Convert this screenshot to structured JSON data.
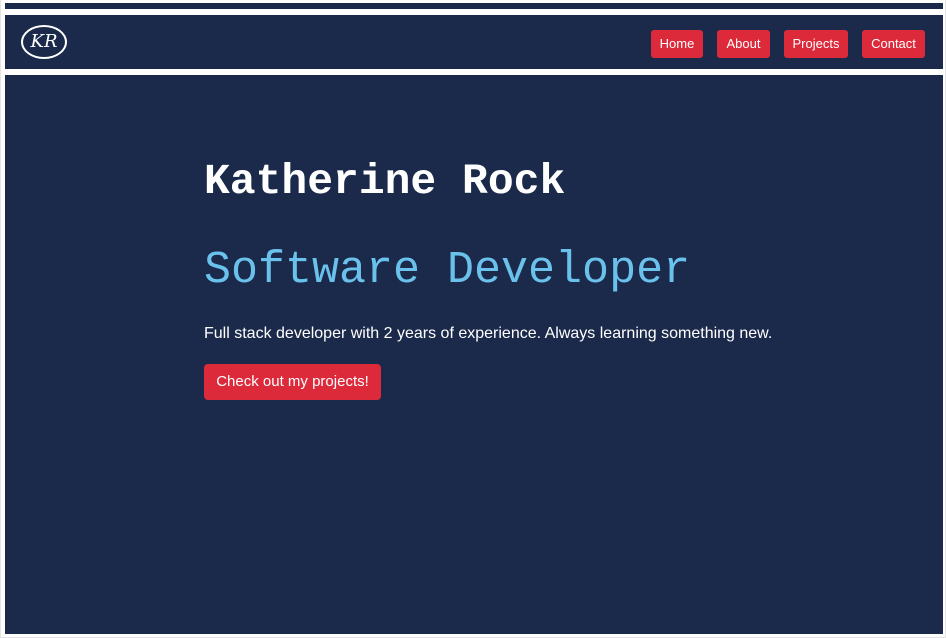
{
  "header": {
    "logo_text": "KR",
    "nav": [
      {
        "label": "Home"
      },
      {
        "label": "About"
      },
      {
        "label": "Projects"
      },
      {
        "label": "Contact"
      }
    ]
  },
  "hero": {
    "name": "Katherine Rock",
    "role": "Software Developer",
    "tagline": "Full stack developer with 2 years of experience. Always learning something new.",
    "cta_label": "Check out my projects!"
  },
  "colors": {
    "background": "#1b2a4a",
    "accent": "#dc2a3b",
    "role_text": "#6ac2ec",
    "text": "#ffffff"
  }
}
